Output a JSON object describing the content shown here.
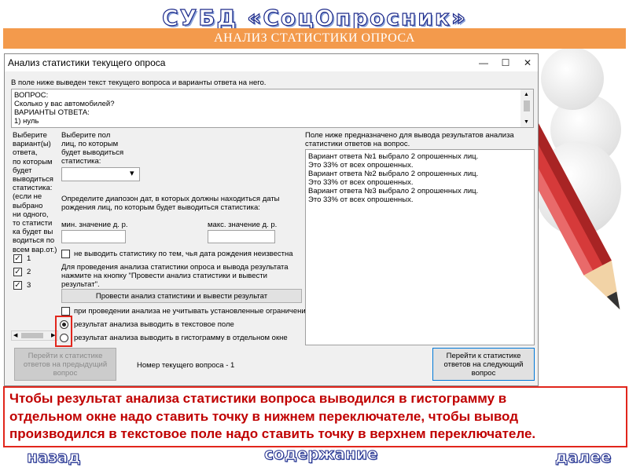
{
  "slide": {
    "title": "СУБД «СоцОпросник»",
    "banner": "АНАЛИЗ СТАТИСТИКИ ОПРОСА",
    "nav_back": "назад",
    "nav_contents": "содержание",
    "nav_next": "далее",
    "note": "Чтобы результат анализа статистики вопроса выводился в гистограмму в\nотдельном окне надо ставить точку в нижнем переключателе, чтобы вывод\nпроизводился в текстовое поле надо ставить точку в верхнем переключателе."
  },
  "window": {
    "title": "Анализ статистики текущего опроса",
    "minimize": "—",
    "maximize": "☐",
    "close": "✕",
    "intro_label": "В поле ниже выведен текст текущего вопроса и варианты ответа на него.",
    "question_text": "ВОПРОС:\nСколько у вас автомобилей?\nВАРИАНТЫ ОТВЕТА:\n1) нуль",
    "variants_label": "Выберите\nвариант(ы)\nответа,\nпо которым\nбудет\nвыводиться\nстатистика:\n(если не\nвыбрано\nни одного,\nто статисти\nка будет вы\nводиться по\nвсем вар.от.)",
    "variants": [
      {
        "label": "1",
        "checked": true
      },
      {
        "label": "2",
        "checked": true
      },
      {
        "label": "3",
        "checked": true
      }
    ],
    "gender_label": "Выберите пол\nлиц, по которым\nбудет выводиться\nстатистика:",
    "gender_value": "",
    "date_range_label": "Определите диапозон дат, в которых должны находиться даты\nрождения лиц, по которым будет выводиться статистика:",
    "min_label": "мин. значение д. р.",
    "max_label": "макс. значение д. р.",
    "min_value": "",
    "max_value": "",
    "unknown_dob_label": "не выводить статистику по тем, чья дата рождения неизвестна",
    "instruction": "Для проведения анализа статистики опроса и вывода результата\nнажмите на кнопку \"Провести анализ статистики и вывести\nрезультат\".",
    "analyze_button": "Провести анализ статистики и вывести результат",
    "ignore_limits_label": "при проведении анализа не учитывать установленные ограничения",
    "radio_text_label": "результат анализа выводить в текстовое поле",
    "radio_hist_label": "результат анализа выводить в гистограмму в отдельном окне",
    "radio_selected": "text",
    "result_label": "Поле ниже предназначено для вывода результатов анализа\nстатистики ответов на вопрос.",
    "result_text": "Вариант ответа №1 выбрало 2 опрошенных лиц.\nЭто 33% от всех опрошенных.\nВариант ответа №2 выбрало 2 опрошенных лиц.\nЭто 33% от всех опрошенных.\nВариант ответа №3 выбрало 2 опрошенных лиц.\nЭто 33% от всех опрошенных.",
    "prev_button": "Перейти к статистике\nответов на предыдущий\nвопрос",
    "current_question": "Номер текущего вопроса - 1",
    "next_button": "Перейти к статистике\nответов на следующий\nвопрос",
    "scroll_left": "◀",
    "scroll_right": "▶",
    "scroll_up": "▲",
    "scroll_down": "▼",
    "combo_arrow": "▾"
  }
}
